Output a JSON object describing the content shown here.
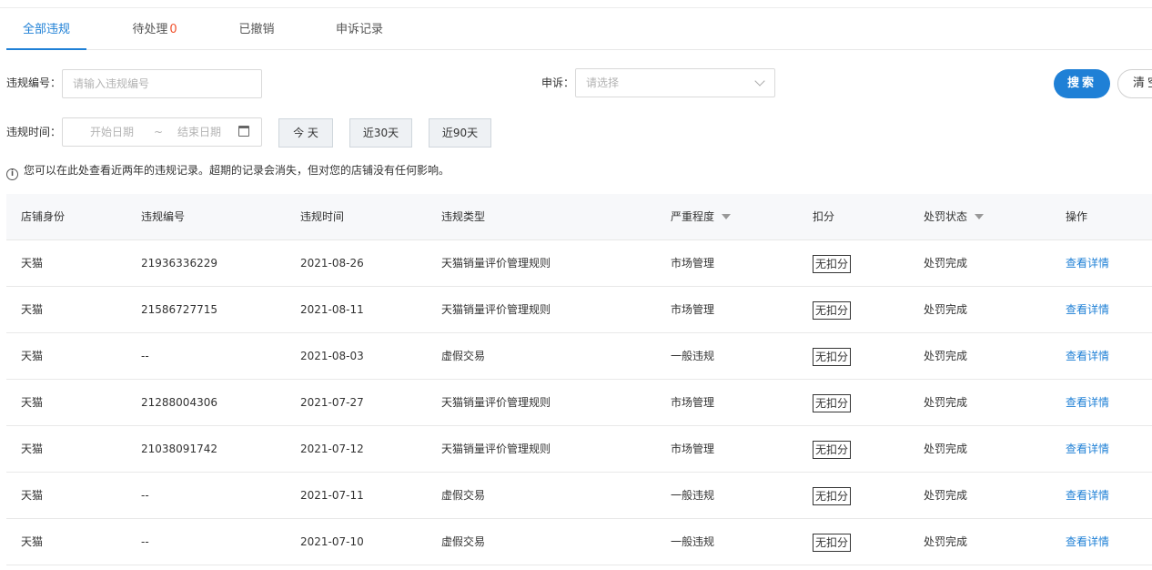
{
  "tabs": [
    {
      "label": "全部违规"
    },
    {
      "label": "待处理",
      "count": "0"
    },
    {
      "label": "已撤销"
    },
    {
      "label": "申诉记录"
    }
  ],
  "filters": {
    "violation_no_label": "违规编号：",
    "violation_no_placeholder": "请输入违规编号",
    "appeal_label": "申诉：",
    "appeal_placeholder": "请选择",
    "time_label": "违规时间：",
    "start_placeholder": "开始日期",
    "range_sep": "~",
    "end_placeholder": "结束日期",
    "quick": [
      "今 天",
      "近30天",
      "近90天"
    ],
    "search_label": "搜索",
    "clear_label": "清空"
  },
  "notice": "您可以在此处查看近两年的违规记录。超期的记录会消失，但对您的店铺没有任何影响。",
  "table": {
    "columns": [
      "店铺身份",
      "违规编号",
      "违规时间",
      "违规类型",
      "严重程度",
      "扣分",
      "处罚状态",
      "操作"
    ],
    "rows": [
      [
        "天猫",
        "21936336229",
        "2021-08-26",
        "天猫销量评价管理规则",
        "市场管理",
        "无扣分",
        "处罚完成",
        "查看详情"
      ],
      [
        "天猫",
        "21586727715",
        "2021-08-11",
        "天猫销量评价管理规则",
        "市场管理",
        "无扣分",
        "处罚完成",
        "查看详情"
      ],
      [
        "天猫",
        "--",
        "2021-08-03",
        "虚假交易",
        "一般违规",
        "无扣分",
        "处罚完成",
        "查看详情"
      ],
      [
        "天猫",
        "21288004306",
        "2021-07-27",
        "天猫销量评价管理规则",
        "市场管理",
        "无扣分",
        "处罚完成",
        "查看详情"
      ],
      [
        "天猫",
        "21038091742",
        "2021-07-12",
        "天猫销量评价管理规则",
        "市场管理",
        "无扣分",
        "处罚完成",
        "查看详情"
      ],
      [
        "天猫",
        "--",
        "2021-07-11",
        "虚假交易",
        "一般违规",
        "无扣分",
        "处罚完成",
        "查看详情"
      ],
      [
        "天猫",
        "--",
        "2021-07-10",
        "虚假交易",
        "一般违规",
        "无扣分",
        "处罚完成",
        "查看详情"
      ]
    ]
  },
  "colors": {
    "accent": "#1f80d6",
    "count": "#f0512d"
  }
}
